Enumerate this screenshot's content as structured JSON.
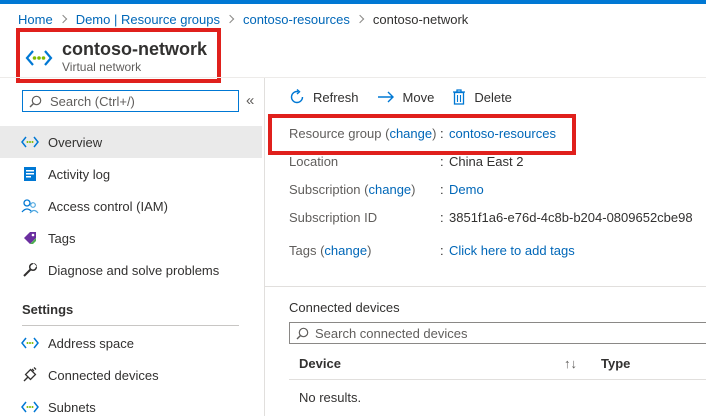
{
  "breadcrumb": {
    "items": [
      "Home",
      "Demo | Resource groups",
      "contoso-resources"
    ],
    "current": "contoso-network"
  },
  "resource": {
    "name": "contoso-network",
    "type": "Virtual network"
  },
  "sidebar": {
    "search_placeholder": "Search (Ctrl+/)",
    "collapse_glyph": "«",
    "items": [
      {
        "label": "Overview",
        "icon": "vnet-icon",
        "active": true
      },
      {
        "label": "Activity log",
        "icon": "activity-log-icon"
      },
      {
        "label": "Access control (IAM)",
        "icon": "iam-people-icon"
      },
      {
        "label": "Tags",
        "icon": "tag-icon"
      },
      {
        "label": "Diagnose and solve problems",
        "icon": "wrench-icon"
      }
    ],
    "section_title": "Settings",
    "settings_items": [
      {
        "label": "Address space",
        "icon": "vnet-icon"
      },
      {
        "label": "Connected devices",
        "icon": "plug-icon"
      },
      {
        "label": "Subnets",
        "icon": "vnet-icon"
      }
    ]
  },
  "toolbar": {
    "refresh_label": "Refresh",
    "move_label": "Move",
    "delete_label": "Delete"
  },
  "essentials": {
    "colon": ":",
    "resource_group_label": "Resource group",
    "change_label": "(change)",
    "change_link": "change",
    "resource_group_value": "contoso-resources",
    "location_label": "Location",
    "location_value": "China East 2",
    "subscription_label": "Subscription",
    "subscription_value": "Demo",
    "subscription_id_label": "Subscription ID",
    "subscription_id_value": "3851f1a6-e76d-4c8b-b204-0809652cbe98",
    "tags_label": "Tags",
    "tags_value": "Click here to add tags"
  },
  "connected_devices": {
    "title": "Connected devices",
    "search_placeholder": "Search connected devices",
    "columns": [
      "Device",
      "Type"
    ],
    "sort_glyph": "↑↓",
    "empty_text": "No results."
  },
  "colors": {
    "accent": "#0078d4",
    "link": "#0067b8",
    "highlight_box": "#e0201c"
  }
}
